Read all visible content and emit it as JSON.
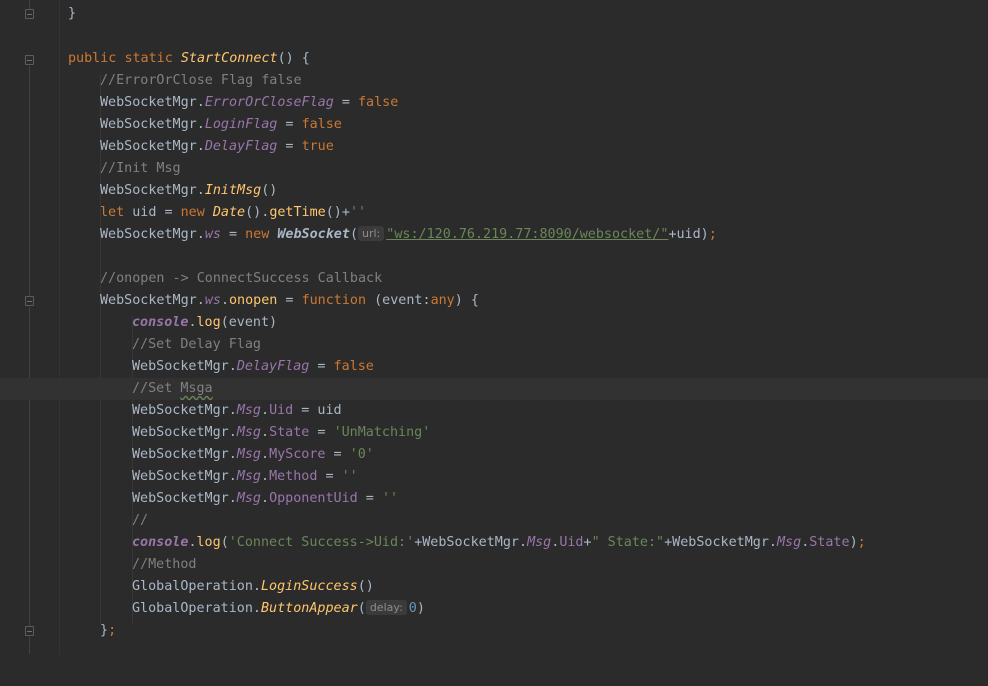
{
  "editor": {
    "language": "javascript",
    "hints": {
      "url": "url:",
      "delay": "delay:"
    },
    "lines": {
      "l0": {
        "brace": "}"
      },
      "l2": {
        "kw1": "public",
        "kw2": "static",
        "fn": "StartConnect",
        "rest": "() {"
      },
      "l3": {
        "comment": "//ErrorOrClose Flag false"
      },
      "l4": {
        "obj": "WebSocketMgr.",
        "prop": "ErrorOrCloseFlag",
        "op": " = ",
        "val": "false"
      },
      "l5": {
        "obj": "WebSocketMgr.",
        "prop": "LoginFlag",
        "op": " = ",
        "val": "false"
      },
      "l6": {
        "obj": "WebSocketMgr.",
        "prop": "DelayFlag",
        "op": " = ",
        "val": "true"
      },
      "l7": {
        "comment": "//Init Msg"
      },
      "l8": {
        "obj": "WebSocketMgr.",
        "fn": "InitMsg",
        "rest": "()"
      },
      "l9": {
        "kw": "let",
        "mid": " uid = ",
        "kw2": "new",
        "cls": "Date",
        "call": "().",
        "fn": "getTime",
        "rest": "()+",
        "str": "''"
      },
      "l10": {
        "obj": "WebSocketMgr.",
        "prop": "ws",
        "op": " = ",
        "kw": "new",
        "cls": "WebSocket",
        "open": "(",
        "url": "\"ws:/120.76.219.77:8090/websocket/\"",
        "rest": "+uid)",
        "semi": ";"
      },
      "l12": {
        "comment": "//onopen -> ConnectSuccess Callback"
      },
      "l13": {
        "obj": "WebSocketMgr.",
        "prop": "ws",
        "dot": ".",
        "fn": "onopen",
        "op": " = ",
        "kw": "function",
        "mid": " (event:",
        "type": "any",
        "rest": ") {"
      },
      "l14": {
        "glob": "console",
        "dot": ".",
        "fn": "log",
        "rest": "(event)"
      },
      "l15": {
        "comment": "//Set Delay Flag"
      },
      "l16": {
        "obj": "WebSocketMgr.",
        "prop": "DelayFlag",
        "op": " = ",
        "val": "false"
      },
      "l17": {
        "comment_a": "//Set ",
        "comment_b": "Msga"
      },
      "l18": {
        "obj": "WebSocketMgr.",
        "prop": "Msg",
        "dot": ".",
        "prop2": "Uid",
        "rest": " = uid"
      },
      "l19": {
        "obj": "WebSocketMgr.",
        "prop": "Msg",
        "dot": ".",
        "prop2": "State",
        "op": " = ",
        "str": "'UnMatching'"
      },
      "l20": {
        "obj": "WebSocketMgr.",
        "prop": "Msg",
        "dot": ".",
        "prop2": "MyScore",
        "op": " = ",
        "str": "'0'"
      },
      "l21": {
        "obj": "WebSocketMgr.",
        "prop": "Msg",
        "dot": ".",
        "prop2": "Method",
        "op": " = ",
        "str": "''"
      },
      "l22": {
        "obj": "WebSocketMgr.",
        "prop": "Msg",
        "dot": ".",
        "prop2": "OpponentUid",
        "op": " = ",
        "str": "''"
      },
      "l23": {
        "comment": "//"
      },
      "l24": {
        "glob": "console",
        "dot": ".",
        "fn": "log",
        "open": "(",
        "str1": "'Connect Success->Uid:'",
        "p1": "+WebSocketMgr.",
        "msg1": "Msg",
        "d1": ".",
        "uid": "Uid",
        "p2": "+",
        "str2": "\" State:\"",
        "p3": "+WebSocketMgr.",
        "msg2": "Msg",
        "d2": ".",
        "state": "State",
        "close": ")",
        "semi": ";"
      },
      "l25": {
        "comment": "//Method"
      },
      "l26": {
        "obj": "GlobalOperation.",
        "fn": "LoginSuccess",
        "rest": "()"
      },
      "l27": {
        "obj": "GlobalOperation.",
        "fn": "ButtonAppear",
        "open": "(",
        "num": "0",
        "rest": ")"
      },
      "l28": {
        "brace": "}",
        "semi": ";"
      }
    }
  },
  "colors": {
    "background": "#2b2b2b",
    "keyword": "#cc7832",
    "function": "#ffc66d",
    "property": "#9876aa",
    "comment": "#808080",
    "string": "#6a8759",
    "number": "#6897bb",
    "text": "#a9b7c6"
  },
  "icons": [
    "fold-icon",
    "lightbulb-icon"
  ]
}
